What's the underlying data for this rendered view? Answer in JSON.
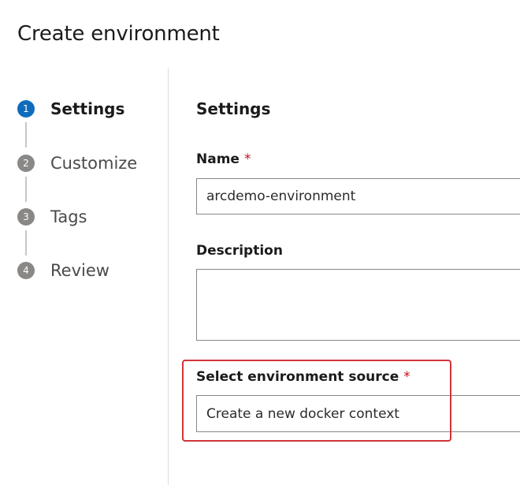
{
  "page": {
    "title": "Create environment"
  },
  "wizard": {
    "steps": [
      {
        "number": "1",
        "label": "Settings",
        "active": true
      },
      {
        "number": "2",
        "label": "Customize",
        "active": false
      },
      {
        "number": "3",
        "label": "Tags",
        "active": false
      },
      {
        "number": "4",
        "label": "Review",
        "active": false
      }
    ]
  },
  "form": {
    "section_title": "Settings",
    "name": {
      "label": "Name",
      "required_marker": "*",
      "value": "arcdemo-environment"
    },
    "description": {
      "label": "Description",
      "value": ""
    },
    "environment_source": {
      "label": "Select environment source",
      "required_marker": "*",
      "value": "Create a new docker context"
    }
  },
  "colors": {
    "active_step": "#0f6cbd",
    "inactive_step": "#8a8886",
    "required": "#c50f1f",
    "highlight": "#d13438"
  },
  "icons": {
    "connector": "step-connector-line"
  }
}
